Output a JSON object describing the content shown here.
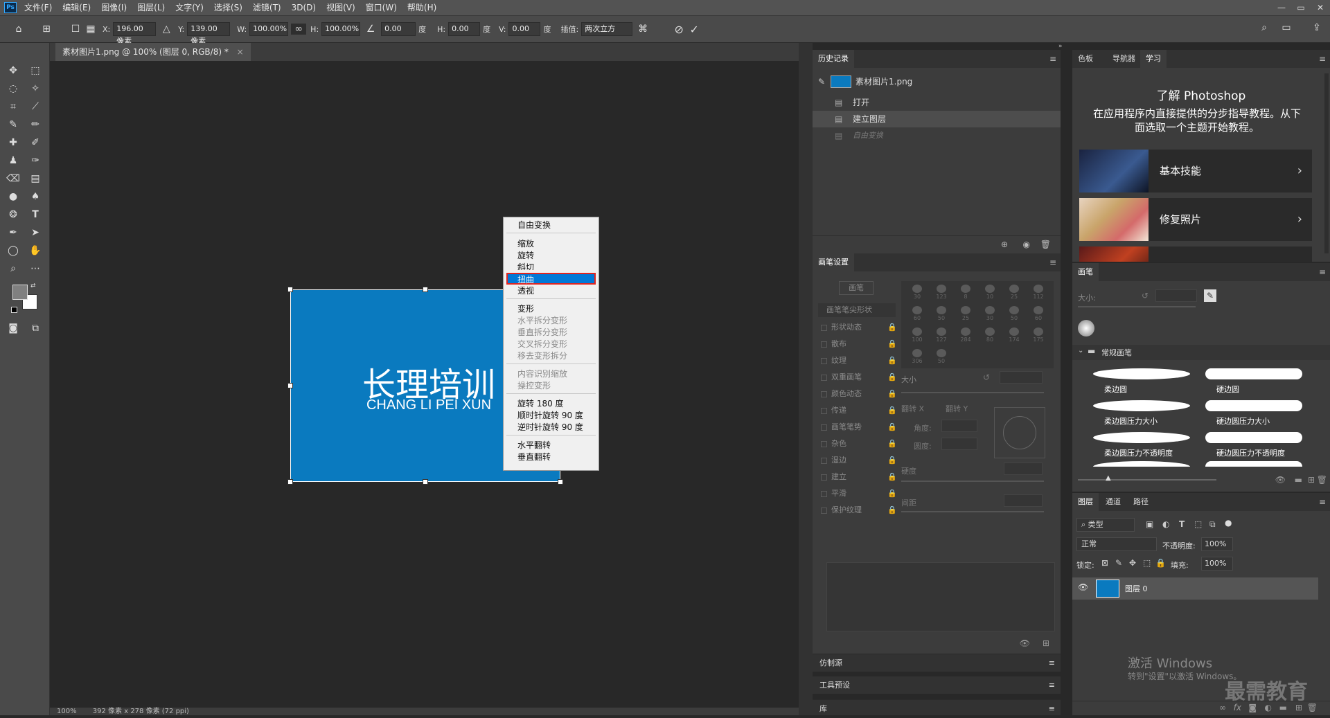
{
  "app": {
    "logo": "Ps"
  },
  "menubar": [
    "文件(F)",
    "编辑(E)",
    "图像(I)",
    "图层(L)",
    "文字(Y)",
    "选择(S)",
    "滤镜(T)",
    "3D(D)",
    "视图(V)",
    "窗口(W)",
    "帮助(H)"
  ],
  "window_controls": [
    "—",
    "▭",
    "✕"
  ],
  "options": {
    "x_label": "X:",
    "x_value": "196.00 像素",
    "y_label": "Y:",
    "y_value": "139.00 像素",
    "w_label": "W:",
    "w_value": "100.00%",
    "h_label": "H:",
    "h_value": "100.00%",
    "angle_value": "0.00",
    "angle_unit": "度",
    "hskew_label": "H:",
    "hskew_value": "0.00",
    "hskew_unit": "度",
    "vskew_label": "V:",
    "vskew_value": "0.00",
    "vskew_unit": "度",
    "interp_label": "插值:",
    "interp_value": "两次立方"
  },
  "document": {
    "tab_title": "素材图片1.png @ 100% (图层 0, RGB/8) *",
    "tab_close": "×",
    "zoom": "100%",
    "doc_info": "392 像素 x 278 像素 (72 ppi)",
    "image_title": "长理培训",
    "image_subtitle": "CHANG LI PEI XUN",
    "image_color": "#0a7abf"
  },
  "context_menu": {
    "items": [
      {
        "label": "自由变换",
        "enabled": true
      },
      {
        "label": "缩放",
        "enabled": true
      },
      {
        "label": "旋转",
        "enabled": true
      },
      {
        "label": "斜切",
        "enabled": true
      },
      {
        "label": "扭曲",
        "enabled": true,
        "selected": true
      },
      {
        "label": "透视",
        "enabled": true
      },
      {
        "label": "变形",
        "enabled": true
      },
      {
        "label": "水平拆分变形",
        "enabled": false
      },
      {
        "label": "垂直拆分变形",
        "enabled": false
      },
      {
        "label": "交叉拆分变形",
        "enabled": false
      },
      {
        "label": "移去变形拆分",
        "enabled": false
      },
      {
        "label": "内容识别缩放",
        "enabled": false
      },
      {
        "label": "操控变形",
        "enabled": false
      },
      {
        "label": "旋转 180 度",
        "enabled": true
      },
      {
        "label": "顺时针旋转 90 度",
        "enabled": true
      },
      {
        "label": "逆时针旋转 90 度",
        "enabled": true
      },
      {
        "label": "水平翻转",
        "enabled": true
      },
      {
        "label": "垂直翻转",
        "enabled": true
      }
    ]
  },
  "history_panel": {
    "title": "历史记录",
    "snapshot": "素材图片1.png",
    "steps": [
      "打开",
      "建立图层",
      "自由变换"
    ]
  },
  "learn_panel": {
    "tabs": [
      "色板",
      "导航器",
      "学习"
    ],
    "heading": "了解 Photoshop",
    "description": "在应用程序内直接提供的分步指导教程。从下面选取一个主题开始教程。",
    "cards": [
      "基本技能",
      "修复照片"
    ]
  },
  "brush_settings": {
    "title": "画笔设置",
    "brushes_button": "画笔",
    "tip_shape": "画笔笔尖形状",
    "options": [
      "形状动态",
      "散布",
      "纹理",
      "双重画笔",
      "颜色动态",
      "传递",
      "画笔笔势",
      "杂色",
      "湿边",
      "建立",
      "平滑",
      "保护纹理"
    ],
    "size_label": "大小",
    "flip_x": "翻转 X",
    "flip_y": "翻转 Y",
    "angle_label": "角度:",
    "roundness_label": "圆度:",
    "hardness_label": "硬度",
    "spacing_label": "间距",
    "preset_sizes": [
      "30",
      "123",
      "8",
      "10",
      "25",
      "112",
      "60",
      "50",
      "25",
      "30",
      "50",
      "60",
      "100",
      "127",
      "284",
      "80",
      "174",
      "175",
      "306",
      "50"
    ]
  },
  "brushes_panel": {
    "title": "画笔",
    "size_label": "大小:",
    "group": "常规画笔",
    "brushes": [
      "柔边圆",
      "硬边圆",
      "柔边圆压力大小",
      "硬边圆压力大小",
      "柔边圆压力不透明度",
      "硬边圆压力不透明度"
    ]
  },
  "collapsed_panels": [
    "仿制源",
    "工具预设",
    "库"
  ],
  "layers_panel": {
    "tabs": [
      "图层",
      "通道",
      "路径"
    ],
    "filter": "类型",
    "blend_mode": "正常",
    "opacity_label": "不透明度:",
    "opacity_value": "100%",
    "lock_label": "锁定:",
    "fill_label": "填充:",
    "fill_value": "100%",
    "layers": [
      {
        "name": "图层 0"
      }
    ]
  },
  "watermark": {
    "activate_line1": "激活 Windows",
    "activate_line2": "转到\"设置\"以激活 Windows。",
    "brand": "最需教育"
  }
}
